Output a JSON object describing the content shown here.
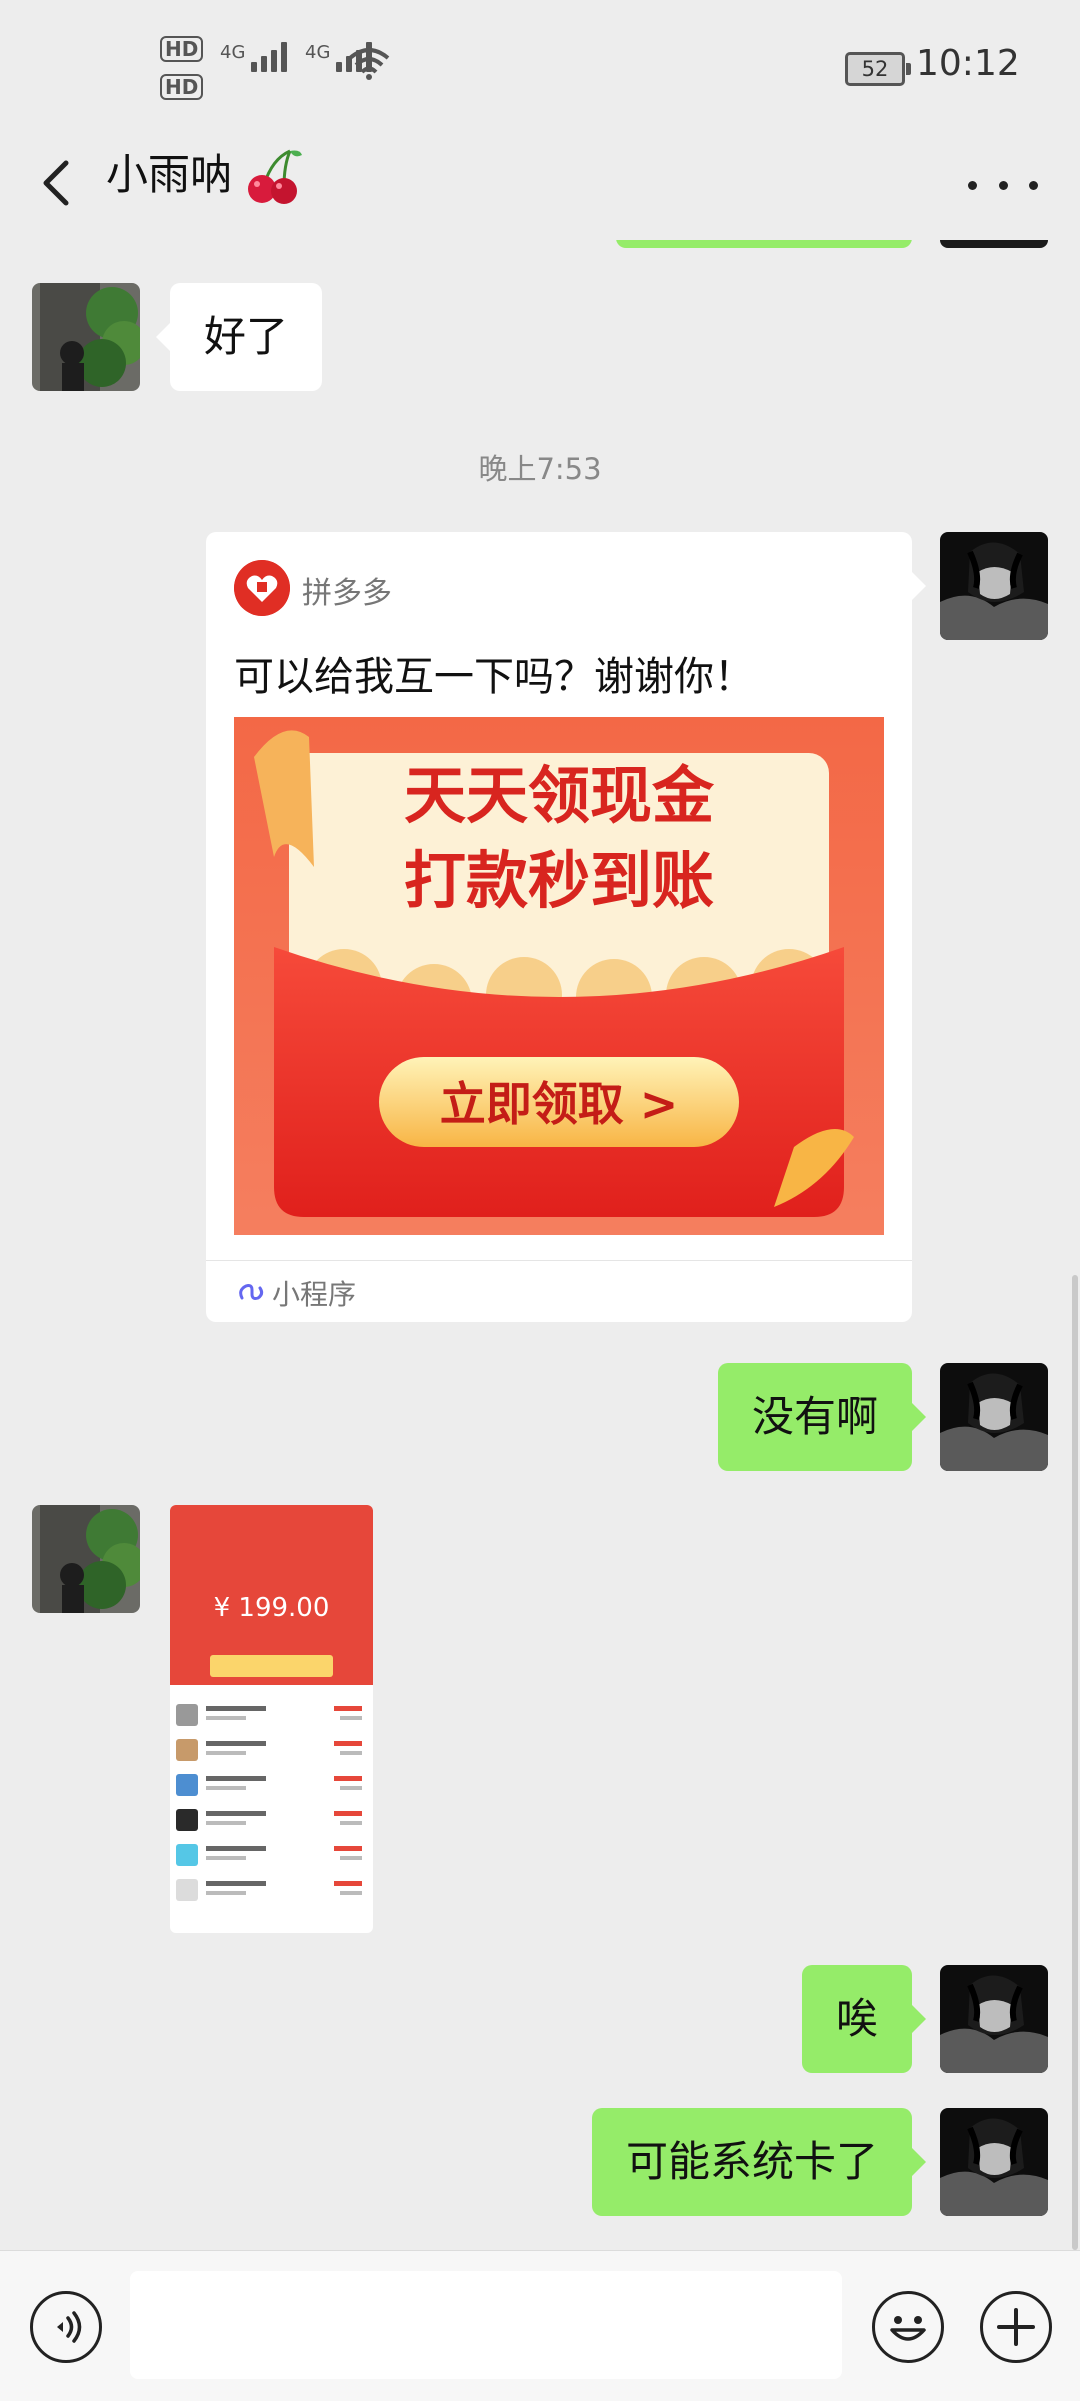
{
  "status_bar": {
    "hd1": "HD",
    "hd2": "HD",
    "sim1_label": "4G",
    "sim2_label": "4G",
    "battery": "52",
    "time": "10:12"
  },
  "header": {
    "title": "小雨呐",
    "title_emoji_icon": "cherries-icon",
    "back_icon": "back-arrow-icon",
    "more_icon": "more-icon"
  },
  "messages": [
    {
      "side": "left",
      "type": "text",
      "text": "好了"
    },
    {
      "type": "time",
      "text": "晚上7:53"
    },
    {
      "side": "right",
      "type": "mini_program",
      "app_name": "拼多多",
      "title": "可以给我互一下吗？谢谢你！",
      "poster_line1": "天天领现金",
      "poster_line2": "打款秒到账",
      "poster_button": "立即领取 >",
      "footer_label": "小程序"
    },
    {
      "side": "right",
      "type": "text",
      "text": "没有啊"
    },
    {
      "side": "left",
      "type": "image",
      "amount": "¥ 199.00"
    },
    {
      "side": "right",
      "type": "text",
      "text": "唉"
    },
    {
      "side": "right",
      "type": "text",
      "text": "可能系统卡了"
    }
  ],
  "input_bar": {
    "voice_icon": "voice-icon",
    "emoji_icon": "emoji-icon",
    "plus_icon": "plus-icon",
    "text_value": ""
  },
  "colors": {
    "background": "#ededed",
    "bubble_green": "#95ec69",
    "bubble_white": "#ffffff",
    "pdd_red": "#e02e24"
  }
}
